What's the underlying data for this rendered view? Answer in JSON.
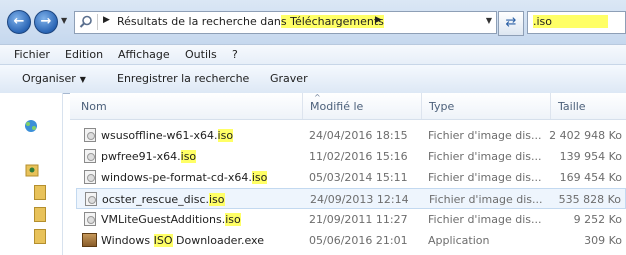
{
  "address": {
    "prefix": "Résultats de la recherche dan",
    "hl_s": "s",
    "location": " Téléchargements",
    "spacer": " "
  },
  "search": {
    "value": ".iso"
  },
  "menu": {
    "items": [
      "Fichier",
      "Edition",
      "Affichage",
      "Outils",
      "?"
    ]
  },
  "toolbar": {
    "organize": "Organiser",
    "save_search": "Enregistrer la recherche",
    "burn": "Graver"
  },
  "columns": {
    "name": "Nom",
    "modified": "Modifié le",
    "type": "Type",
    "size": "Taille"
  },
  "files": [
    {
      "name_pre": "wsusoffline-w61-x64.",
      "name_hl": "iso",
      "name_post": "",
      "date": "24/04/2016 18:15",
      "type": "Fichier d'image dis...",
      "size": "2 402 948 Ko",
      "icon": "disc-image-icon"
    },
    {
      "name_pre": "pwfree91-x64.",
      "name_hl": "iso",
      "name_post": "",
      "date": "11/02/2016 15:16",
      "type": "Fichier d'image dis...",
      "size": "139 954 Ko",
      "icon": "disc-image-icon"
    },
    {
      "name_pre": "windows-pe-format-cd-x64.",
      "name_hl": "iso",
      "name_post": "",
      "date": "05/03/2014 15:11",
      "type": "Fichier d'image dis...",
      "size": "169 454 Ko",
      "icon": "disc-image-icon"
    },
    {
      "name_pre": "ocster_rescue_disc.",
      "name_hl": "iso",
      "name_post": "",
      "date": "24/09/2013 12:14",
      "type": "Fichier d'image dis...",
      "size": "535 828 Ko",
      "icon": "disc-image-icon"
    },
    {
      "name_pre": "VMLiteGuestAdditions.",
      "name_hl": "iso",
      "name_post": "",
      "date": "21/09/2011 11:27",
      "type": "Fichier d'image dis...",
      "size": "9 252 Ko",
      "icon": "disc-image-icon"
    },
    {
      "name_pre": "Windows ",
      "name_hl": "ISO",
      "name_post": " Downloader.exe",
      "date": "05/06/2016 21:01",
      "type": "Application",
      "size": "309 Ko",
      "icon": "application-icon"
    }
  ]
}
